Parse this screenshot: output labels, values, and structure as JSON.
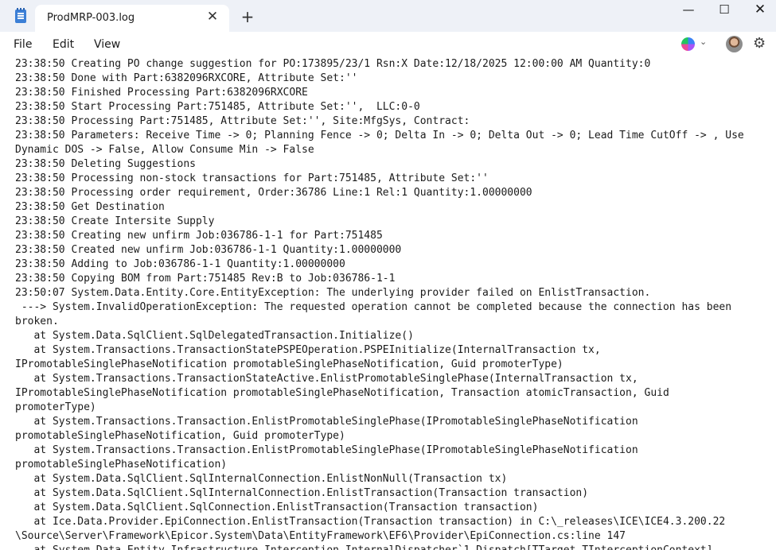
{
  "window": {
    "tab_title": "ProdMRP-003.log",
    "tab_close_glyph": "✕",
    "new_tab_glyph": "+",
    "minimize_glyph": "—",
    "maximize_glyph": "☐",
    "close_glyph": "✕"
  },
  "menu": {
    "file": "File",
    "edit": "Edit",
    "view": "View",
    "copilot_chevron": "⌄",
    "settings_glyph": "⚙"
  },
  "icons": {
    "app": "notepad-icon",
    "copilot": "copilot-icon",
    "avatar": "user-avatar",
    "settings": "gear-icon"
  },
  "editor": {
    "lines": [
      "23:38:50 Creating PO change suggestion for PO:173895/23/1 Rsn:X Date:12/18/2025 12:00:00 AM Quantity:0",
      "23:38:50 Done with Part:6382096RXCORE, Attribute Set:''",
      "23:38:50 Finished Processing Part:6382096RXCORE",
      "23:38:50 Start Processing Part:751485, Attribute Set:'',  LLC:0-0",
      "23:38:50 Processing Part:751485, Attribute Set:'', Site:MfgSys, Contract:",
      "23:38:50 Parameters: Receive Time -> 0; Planning Fence -> 0; Delta In -> 0; Delta Out -> 0; Lead Time CutOff -> , Use",
      "Dynamic DOS -> False, Allow Consume Min -> False",
      "23:38:50 Deleting Suggestions",
      "23:38:50 Processing non-stock transactions for Part:751485, Attribute Set:''",
      "23:38:50 Processing order requirement, Order:36786 Line:1 Rel:1 Quantity:1.00000000",
      "23:38:50 Get Destination",
      "23:38:50 Create Intersite Supply",
      "23:38:50 Creating new unfirm Job:036786-1-1 for Part:751485",
      "23:38:50 Created new unfirm Job:036786-1-1 Quantity:1.00000000",
      "23:38:50 Adding to Job:036786-1-1 Quantity:1.00000000",
      "23:38:50 Copying BOM from Part:751485 Rev:B to Job:036786-1-1",
      "23:50:07 System.Data.Entity.Core.EntityException: The underlying provider failed on EnlistTransaction.",
      " ---> System.InvalidOperationException: The requested operation cannot be completed because the connection has been",
      "broken.",
      "   at System.Data.SqlClient.SqlDelegatedTransaction.Initialize()",
      "   at System.Transactions.TransactionStatePSPEOperation.PSPEInitialize(InternalTransaction tx,",
      "IPromotableSinglePhaseNotification promotableSinglePhaseNotification, Guid promoterType)",
      "   at System.Transactions.TransactionStateActive.EnlistPromotableSinglePhase(InternalTransaction tx,",
      "IPromotableSinglePhaseNotification promotableSinglePhaseNotification, Transaction atomicTransaction, Guid",
      "promoterType)",
      "   at System.Transactions.Transaction.EnlistPromotableSinglePhase(IPromotableSinglePhaseNotification",
      "promotableSinglePhaseNotification, Guid promoterType)",
      "   at System.Transactions.Transaction.EnlistPromotableSinglePhase(IPromotableSinglePhaseNotification",
      "promotableSinglePhaseNotification)",
      "   at System.Data.SqlClient.SqlInternalConnection.EnlistNonNull(Transaction tx)",
      "   at System.Data.SqlClient.SqlInternalConnection.EnlistTransaction(Transaction transaction)",
      "   at System.Data.SqlClient.SqlConnection.EnlistTransaction(Transaction transaction)",
      "   at Ice.Data.Provider.EpiConnection.EnlistTransaction(Transaction transaction) in C:\\_releases\\ICE\\ICE4.3.200.22",
      "\\Source\\Server\\Framework\\Epicor.System\\Data\\EntityFramework\\EF6\\Provider\\EpiConnection.cs:line 147",
      "   at System.Data.Entity.Infrastructure.Interception.InternalDispatcher`1.Dispatch[TTarget,TInterceptionContext]"
    ]
  }
}
